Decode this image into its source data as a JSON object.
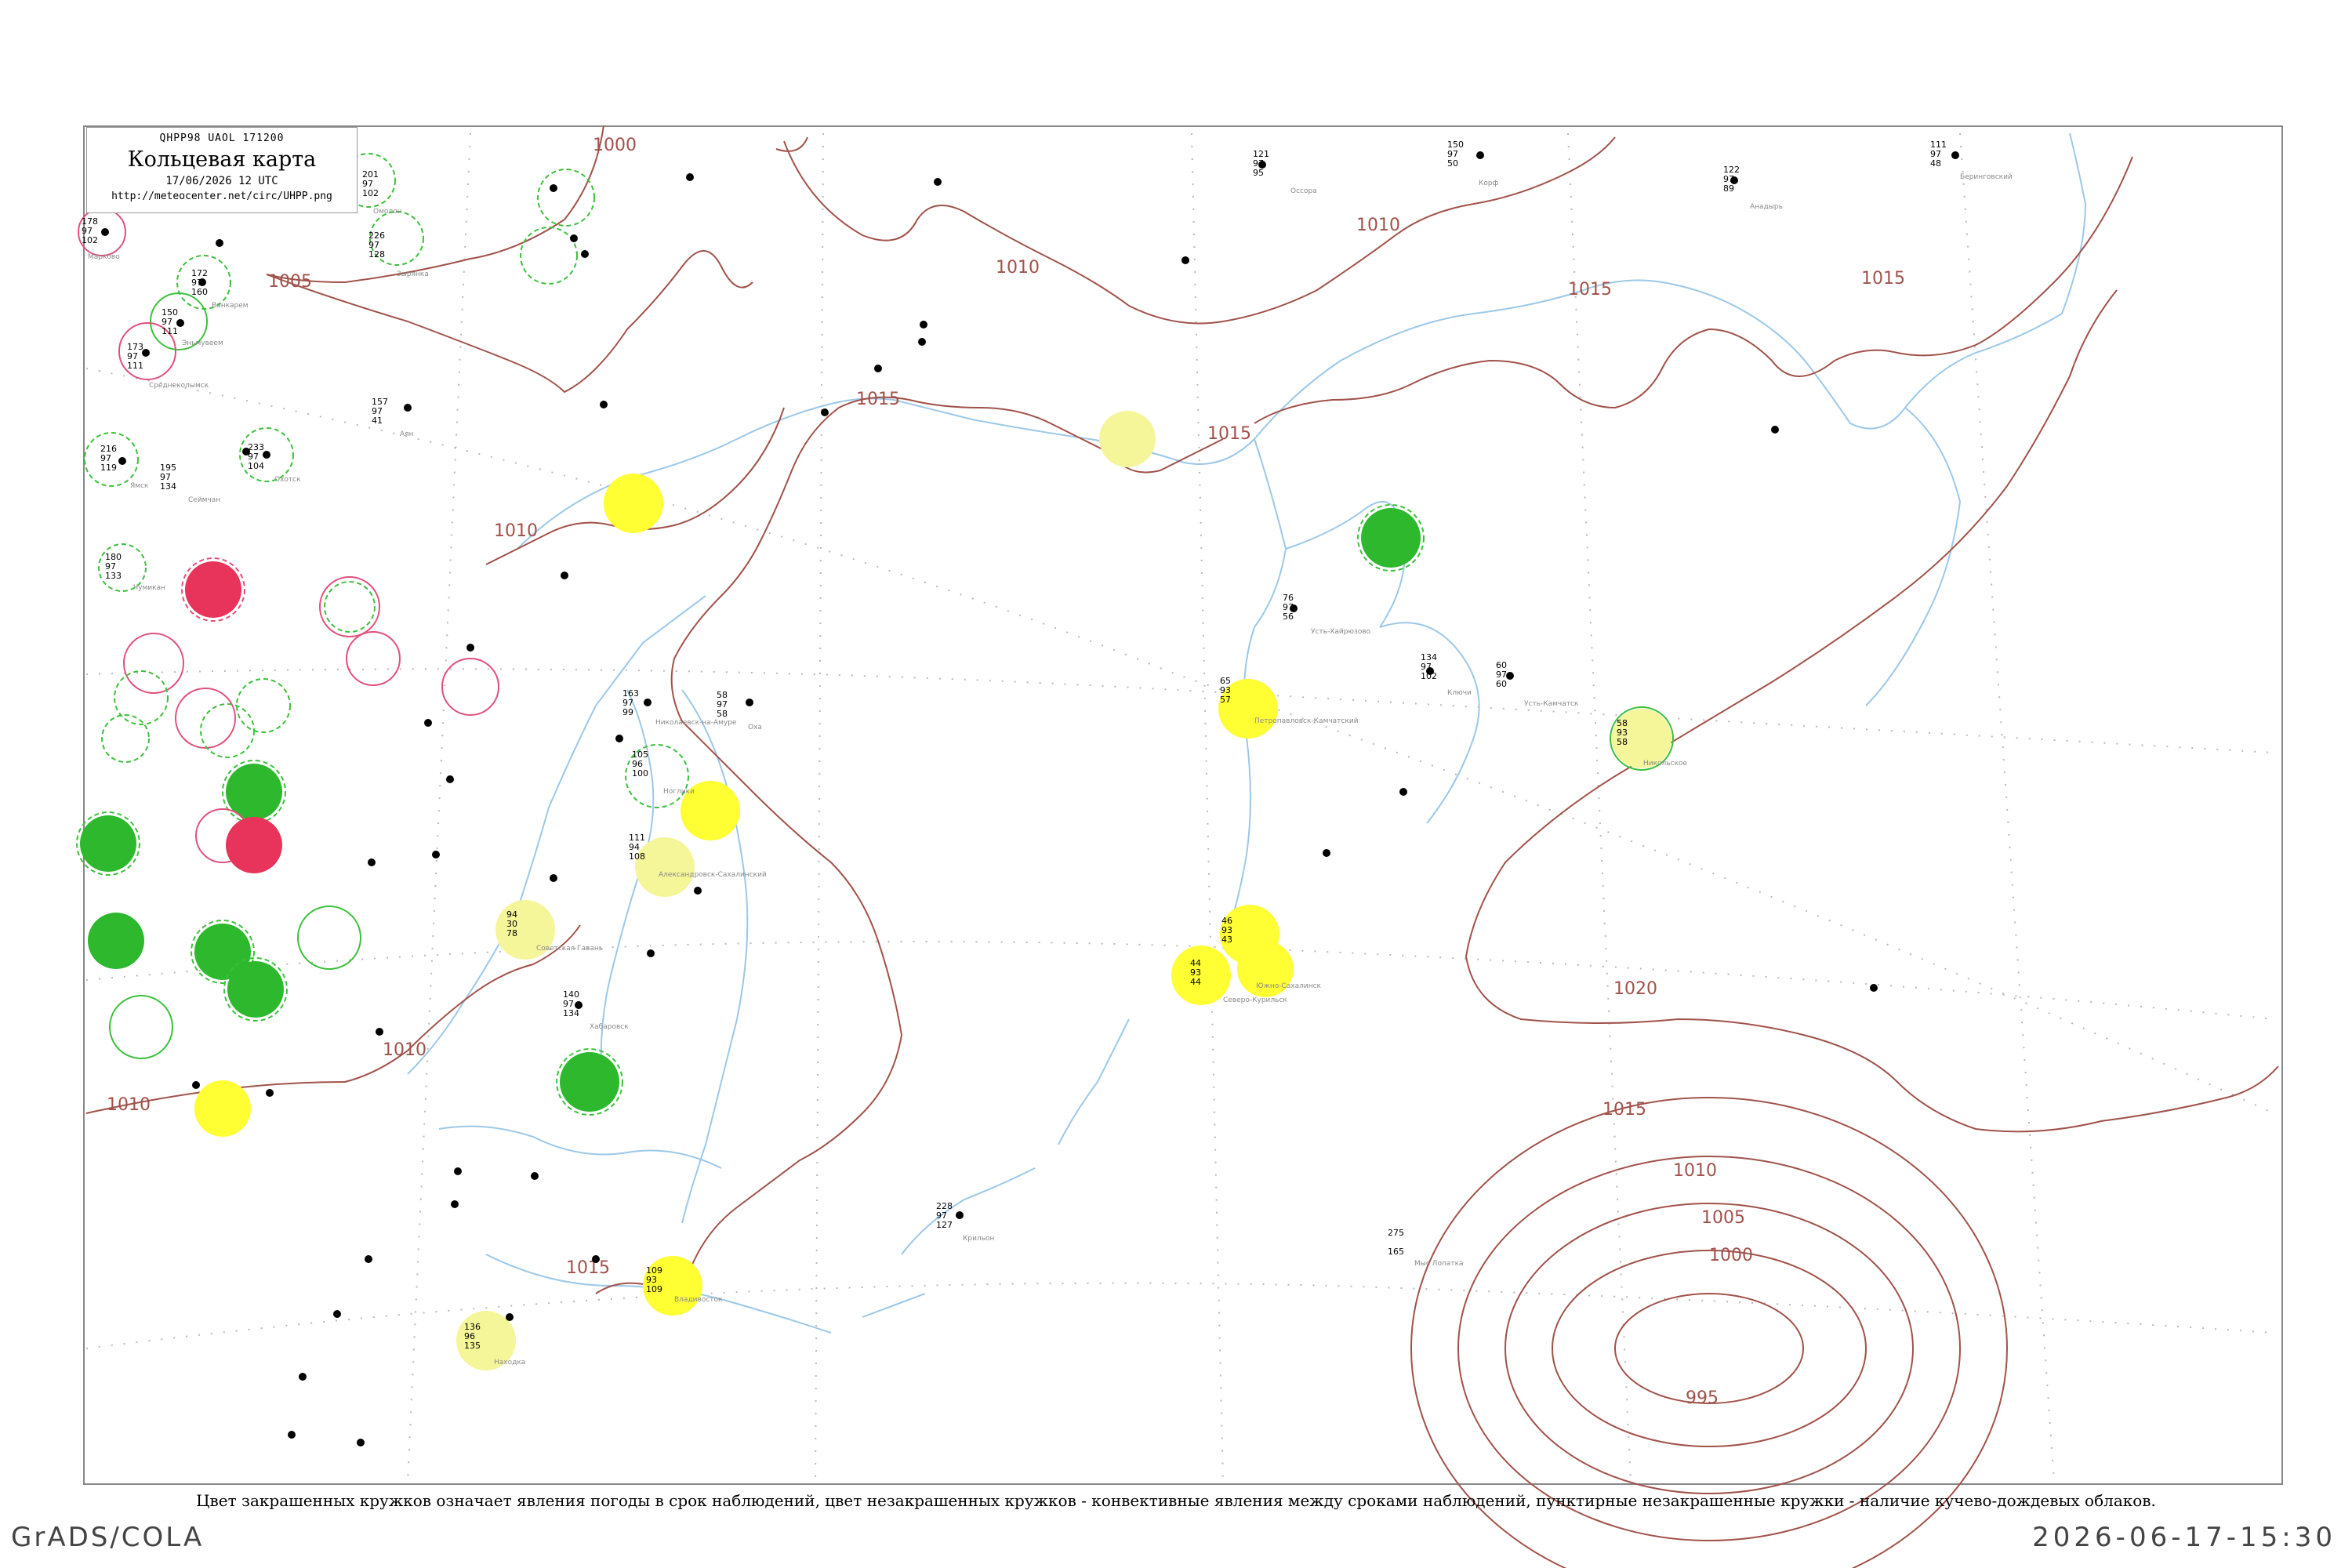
{
  "header": {
    "code": "QHPP98  UAOL  171200",
    "title": "Кольцевая карта",
    "date": "17/06/2026 12 UTC",
    "url": "http://meteocenter.net/circ/UHPP.png"
  },
  "legend_note": "Цвет закрашенных кружков означает явления погоды в срок наблюдений, цвет незакрашенных кружков - конвективные явления между сроками наблюдений, пунктирные незакрашенные кружки - наличие кучево-дождевых облаков.",
  "footer": {
    "left": "GrADS/COLA",
    "right": "2026-06-17-15:30"
  },
  "colors": {
    "isobar": "#a0524a",
    "coast": "#9cc8e8",
    "grid": "#b0b0b0",
    "rain": "#ffff33",
    "light_rain": "#f5f59a",
    "shower": "#2db82d",
    "thunder": "#e8335a",
    "conv_green": "#3cc03c",
    "conv_red": "#e0507a"
  },
  "isobar_labels": [
    "1000",
    "1005",
    "1010",
    "1010",
    "1010",
    "1010",
    "1015",
    "1015",
    "1015",
    "1015",
    "1020",
    "1015",
    "1010",
    "1005",
    "1000",
    "995",
    "1010",
    "1015"
  ],
  "stations": [
    {
      "name": "Марково",
      "p": "178",
      "t": "97",
      "d": "102"
    },
    {
      "name": "Омолон",
      "p": "201",
      "t": "97",
      "d": "102"
    },
    {
      "name": "Зырянка",
      "p": "226",
      "t": "97",
      "d": "128"
    },
    {
      "name": "Ванкарем",
      "p": "172",
      "t": "97",
      "d": "160"
    },
    {
      "name": "Эньмувеем",
      "p": "150",
      "t": "97",
      "d": "111"
    },
    {
      "name": "Среднеколымск",
      "p": "173",
      "t": "97",
      "d": "111"
    },
    {
      "name": "Ямск",
      "p": "216",
      "t": "97",
      "d": "119"
    },
    {
      "name": "Сеймчан",
      "p": "195",
      "t": "97",
      "d": "134"
    },
    {
      "name": "Охотск",
      "p": "233",
      "t": "97",
      "d": "104"
    },
    {
      "name": "Аян",
      "p": "157",
      "t": "97",
      "d": "41"
    },
    {
      "name": "Чумикан",
      "p": "180",
      "t": "97",
      "d": "133"
    },
    {
      "name": "Николаевск-на-Амуре",
      "p": "163",
      "t": "97",
      "d": "99"
    },
    {
      "name": "Оха",
      "p": "58",
      "t": "97",
      "d": "58"
    },
    {
      "name": "Ноглики",
      "p": "105",
      "t": "96",
      "d": "100"
    },
    {
      "name": "Александровск-Сахалинский",
      "p": "111",
      "t": "94",
      "d": "108"
    },
    {
      "name": "Южно-Сахалинск",
      "p": "46",
      "t": "93",
      "d": "43"
    },
    {
      "name": "Северо-Курильск",
      "p": "44",
      "t": "93",
      "d": "44"
    },
    {
      "name": "Петропавловск-Камчатский",
      "p": "65",
      "t": "93",
      "d": "57"
    },
    {
      "name": "Усть-Камчатск",
      "p": "60",
      "t": "97",
      "d": "60"
    },
    {
      "name": "Ключи",
      "p": "134",
      "t": "97",
      "d": "102"
    },
    {
      "name": "Никольское",
      "p": "58",
      "t": "93",
      "d": "58"
    },
    {
      "name": "Усть-Хайрюзово",
      "p": "76",
      "t": "97",
      "d": "56"
    },
    {
      "name": "Оссора",
      "p": "121",
      "t": "97",
      "d": "95"
    },
    {
      "name": "Корф",
      "p": "150",
      "t": "97",
      "d": "50"
    },
    {
      "name": "Анадырь",
      "p": "122",
      "t": "97",
      "d": "89"
    },
    {
      "name": "Беринговский",
      "p": "111",
      "t": "97",
      "d": "48"
    },
    {
      "name": "Хабаровск",
      "p": "140",
      "t": "97",
      "d": "134"
    },
    {
      "name": "Советская Гавань",
      "p": "94",
      "t": "30",
      "d": "78"
    },
    {
      "name": "Владивосток",
      "p": "109",
      "t": "93",
      "d": "109"
    },
    {
      "name": "Находка",
      "p": "136",
      "t": "96",
      "d": "135"
    },
    {
      "name": "Крильон",
      "p": "228",
      "t": "97",
      "d": "127"
    },
    {
      "name": "Мыс Лопатка",
      "p": "275",
      "t": "",
      "d": "165"
    }
  ]
}
